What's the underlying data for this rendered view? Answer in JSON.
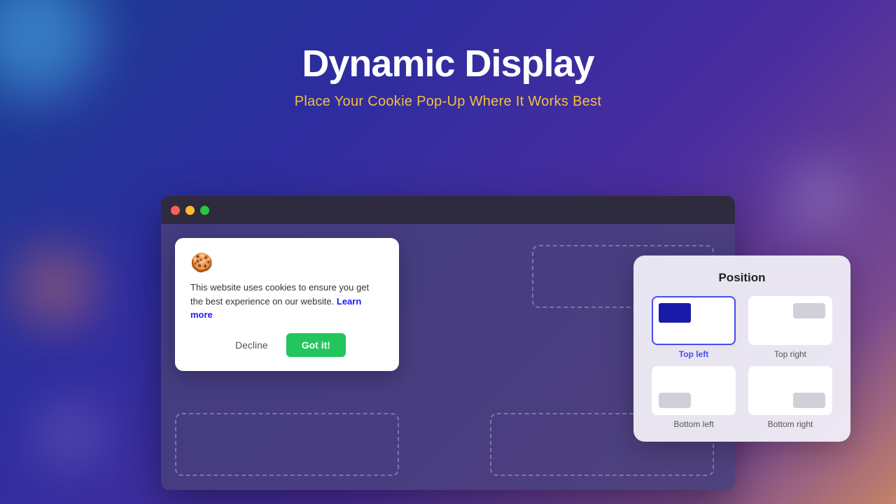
{
  "page": {
    "title": "Dynamic Display",
    "subtitle": "Place Your Cookie Pop-Up Where It Works Best"
  },
  "browser": {
    "dots": [
      "red",
      "yellow",
      "green"
    ]
  },
  "cookie_popup": {
    "icon": "🍪",
    "text": "This website uses cookies to ensure you get the best experience on our website.",
    "link_text": "Learn more",
    "decline_label": "Decline",
    "accept_label": "Got it!"
  },
  "position_panel": {
    "title": "Position",
    "options": [
      {
        "id": "top-left",
        "label": "Top left",
        "active": true
      },
      {
        "id": "top-right",
        "label": "Top right",
        "active": false
      },
      {
        "id": "bottom-left",
        "label": "Bottom left",
        "active": false
      },
      {
        "id": "bottom-right",
        "label": "Bottom right",
        "active": false
      }
    ]
  },
  "colors": {
    "accent": "#4a4af0",
    "green": "#22c55e",
    "dark_navy": "#1a1aaa"
  }
}
